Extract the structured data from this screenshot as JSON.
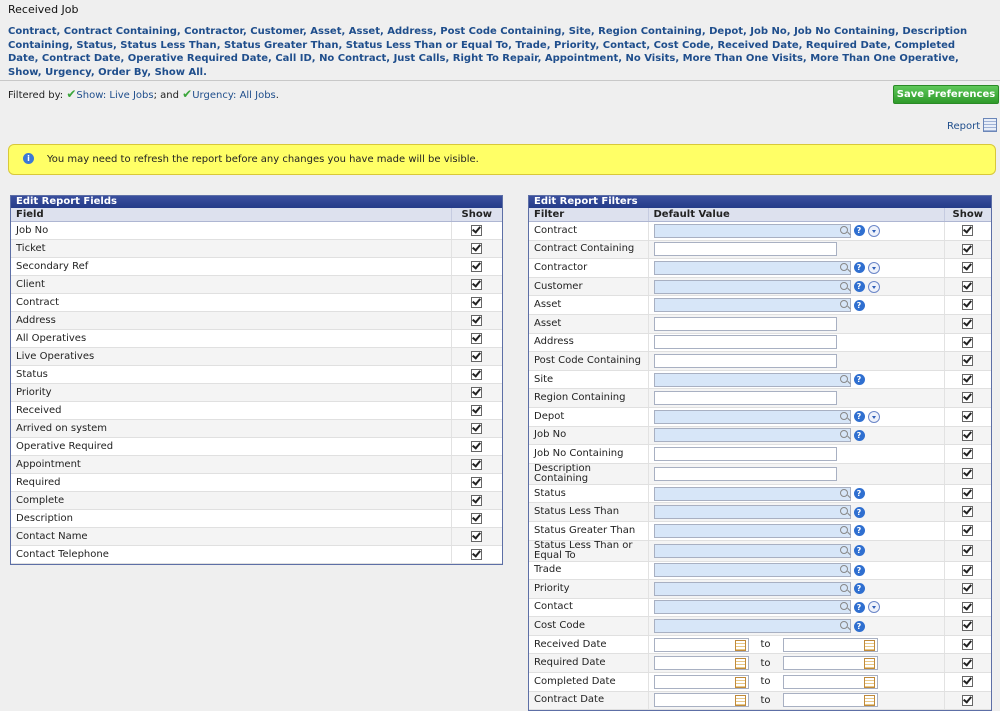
{
  "page_title": "Received Job",
  "filter_links": [
    "Contract",
    "Contract Containing",
    "Contractor",
    "Customer",
    "Asset",
    "Asset",
    "Address",
    "Post Code Containing",
    "Site",
    "Region Containing",
    "Depot",
    "Job No",
    "Job No Containing",
    "Description Containing",
    "Status",
    "Status Less Than",
    "Status Greater Than",
    "Status Less Than or Equal To",
    "Trade",
    "Priority",
    "Contact",
    "Cost Code",
    "Received Date",
    "Required Date",
    "Completed Date",
    "Contract Date",
    "Operative Required Date",
    "Call ID",
    "No Contract",
    "Just Calls",
    "Right To Repair",
    "Appointment",
    "No Visits",
    "More Than One Visits",
    "More Than One Operative",
    "Show",
    "Urgency",
    "Order By",
    "Show All."
  ],
  "filtered_by": {
    "prefix": "Filtered by:",
    "f1": "Show: Live Jobs",
    "mid": "; and",
    "f2": "Urgency: All Jobs",
    "suffix": "."
  },
  "save_button": "Save Preferences",
  "report_link": "Report",
  "notice": "You may need to refresh the report before any changes you have made will be visible.",
  "fields_panel": {
    "title": "Edit Report Fields",
    "col_field": "Field",
    "col_show": "Show",
    "rows": [
      "Job No",
      "Ticket",
      "Secondary Ref",
      "Client",
      "Contract",
      "Address",
      "All Operatives",
      "Live Operatives",
      "Status",
      "Priority",
      "Received",
      "Arrived on system",
      "Operative Required",
      "Appointment",
      "Required",
      "Complete",
      "Description",
      "Contact Name",
      "Contact Telephone"
    ]
  },
  "filters_panel": {
    "title": "Edit Report Filters",
    "col_filter": "Filter",
    "col_default": "Default Value",
    "col_show": "Show",
    "to_label": "to",
    "rows": [
      {
        "name": "Contract",
        "kind": "lookup",
        "dropdown": true
      },
      {
        "name": "Contract Containing",
        "kind": "text"
      },
      {
        "name": "Contractor",
        "kind": "lookup",
        "dropdown": true
      },
      {
        "name": "Customer",
        "kind": "lookup",
        "dropdown": true
      },
      {
        "name": "Asset",
        "kind": "lookup",
        "dropdown": false
      },
      {
        "name": "Asset",
        "kind": "text"
      },
      {
        "name": "Address",
        "kind": "text"
      },
      {
        "name": "Post Code Containing",
        "kind": "text"
      },
      {
        "name": "Site",
        "kind": "lookup",
        "dropdown": false
      },
      {
        "name": "Region Containing",
        "kind": "text"
      },
      {
        "name": "Depot",
        "kind": "lookup",
        "dropdown": true
      },
      {
        "name": "Job No",
        "kind": "lookup",
        "dropdown": false
      },
      {
        "name": "Job No Containing",
        "kind": "text"
      },
      {
        "name": "Description Containing",
        "kind": "text"
      },
      {
        "name": "Status",
        "kind": "lookup",
        "dropdown": false
      },
      {
        "name": "Status Less Than",
        "kind": "lookup",
        "dropdown": false
      },
      {
        "name": "Status Greater Than",
        "kind": "lookup",
        "dropdown": false
      },
      {
        "name": "Status Less Than or Equal To",
        "kind": "lookup",
        "dropdown": false
      },
      {
        "name": "Trade",
        "kind": "lookup",
        "dropdown": false
      },
      {
        "name": "Priority",
        "kind": "lookup",
        "dropdown": false
      },
      {
        "name": "Contact",
        "kind": "lookup",
        "dropdown": true
      },
      {
        "name": "Cost Code",
        "kind": "lookup",
        "dropdown": false
      },
      {
        "name": "Received Date",
        "kind": "date"
      },
      {
        "name": "Required Date",
        "kind": "date"
      },
      {
        "name": "Completed Date",
        "kind": "date"
      },
      {
        "name": "Contract Date",
        "kind": "date"
      }
    ]
  },
  "icons": {
    "help": "help-circle-icon",
    "dropdown": "chevron-down-icon",
    "lookup": "magnifier-icon",
    "calendar": "calendar-icon",
    "check": "checkmark-icon"
  }
}
